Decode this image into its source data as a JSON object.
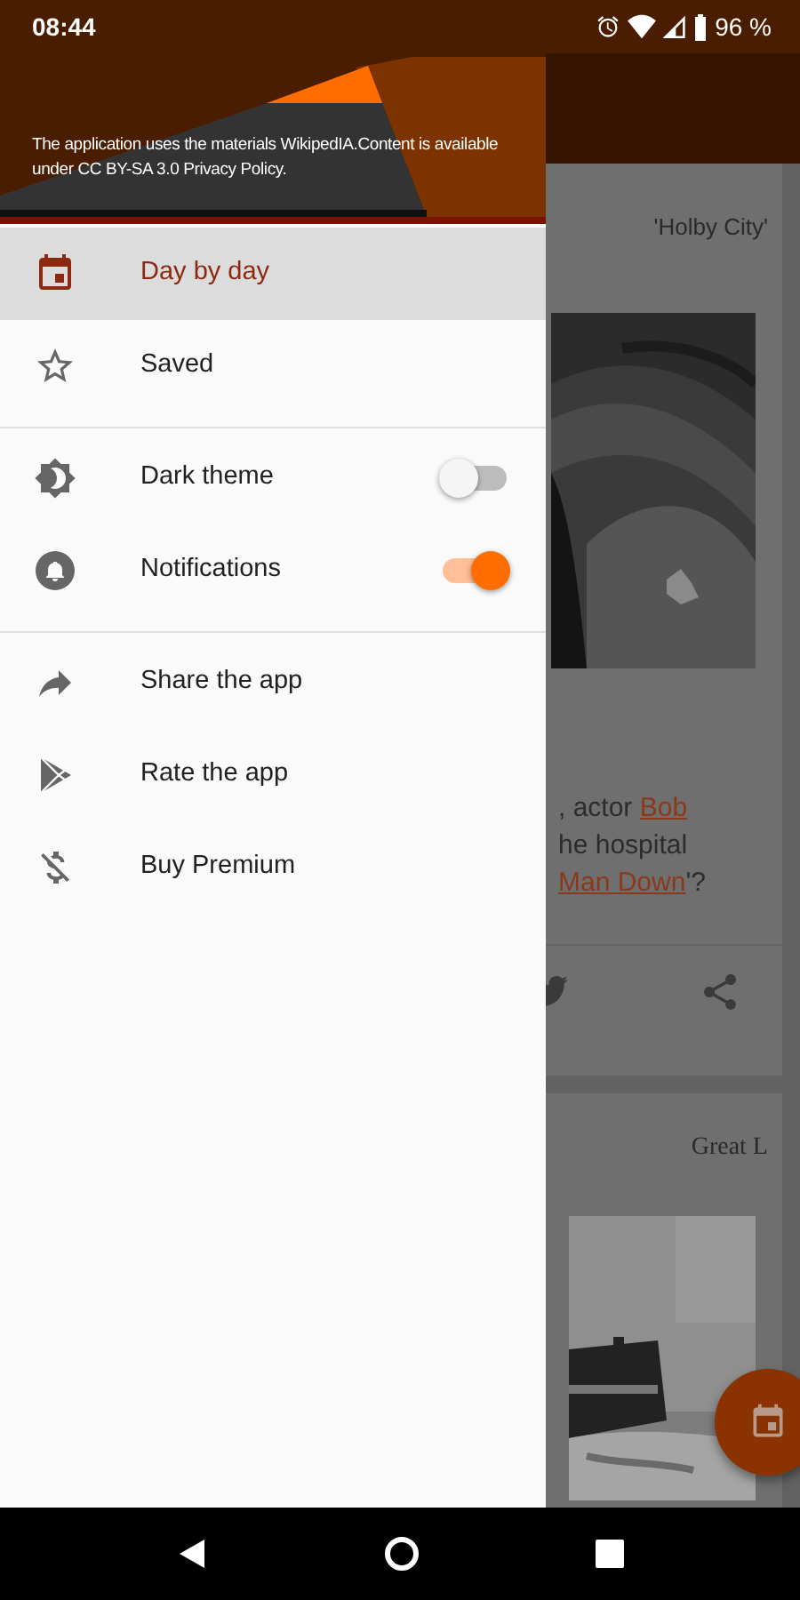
{
  "status_bar": {
    "time": "08:44",
    "battery": "96 %"
  },
  "drawer": {
    "header_text": "The application uses the materials WikipedIA.Content is available under CC BY-SA 3.0 Privacy Policy.",
    "groups": [
      {
        "items": [
          {
            "kind": "nav",
            "label": "Day by day",
            "selected": true
          },
          {
            "kind": "nav",
            "label": "Saved",
            "selected": false
          }
        ]
      },
      {
        "items": [
          {
            "kind": "toggle",
            "label": "Dark theme",
            "on": false
          },
          {
            "kind": "toggle",
            "label": "Notifications",
            "on": true
          }
        ]
      },
      {
        "items": [
          {
            "kind": "nav",
            "label": "Share the app",
            "selected": false
          },
          {
            "kind": "nav",
            "label": "Rate the app",
            "selected": false
          },
          {
            "kind": "nav",
            "label": "Buy Premium",
            "selected": false
          }
        ]
      }
    ]
  },
  "background": {
    "cards": [
      {
        "title": "'Holby City'",
        "lines": [
          [
            {
              "text": ", actor ",
              "link": false
            },
            {
              "text": "Bob",
              "link": true
            }
          ],
          [
            {
              "text": "he hospital",
              "link": false
            }
          ],
          [
            {
              "text": "Man Down",
              "link": true
            },
            {
              "text": "'?",
              "link": false
            }
          ]
        ]
      },
      {
        "title": "Great L"
      }
    ]
  }
}
